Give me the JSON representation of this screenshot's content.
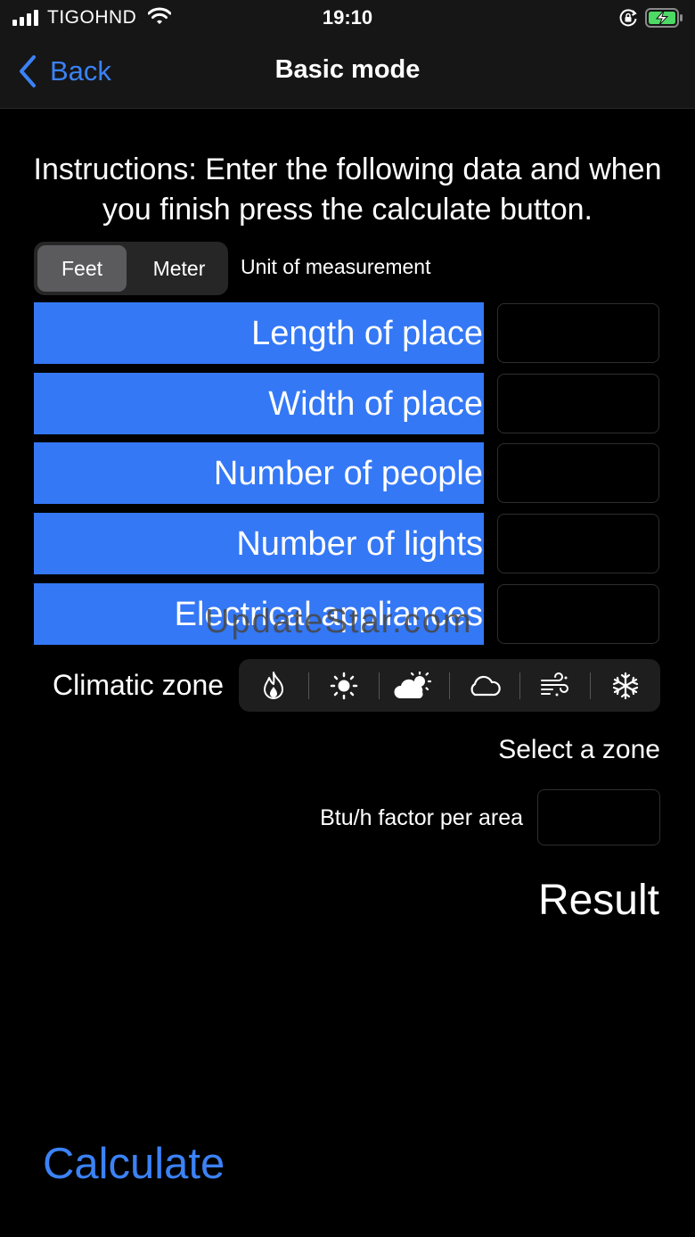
{
  "status_bar": {
    "carrier": "TIGOHND",
    "time": "19:10",
    "icons": [
      "signal-icon",
      "wifi-icon",
      "rotation-lock-icon",
      "battery-charging-icon"
    ]
  },
  "nav": {
    "back_label": "Back",
    "title": "Basic mode"
  },
  "instructions": "Instructions: Enter the following data and when you finish press the calculate button.",
  "unit": {
    "options": [
      "Feet",
      "Meter"
    ],
    "selected": "Feet",
    "label": "Unit of measurement"
  },
  "fields": [
    {
      "label": "Length of place",
      "value": ""
    },
    {
      "label": "Width of place",
      "value": ""
    },
    {
      "label": "Number of people",
      "value": ""
    },
    {
      "label": "Number of lights",
      "value": ""
    },
    {
      "label": "Electrical appliances",
      "value": ""
    }
  ],
  "watermark": "UpdateStar.com",
  "climatic_zone": {
    "label": "Climatic zone",
    "options": [
      "flame-icon",
      "sun-icon",
      "sun-behind-cloud-icon",
      "cloud-icon",
      "wind-icon",
      "snowflake-icon"
    ],
    "status": "Select a zone"
  },
  "factor": {
    "label": "Btu/h factor per area",
    "value": ""
  },
  "result_label": "Result",
  "calculate_label": "Calculate",
  "colors": {
    "accent": "#3b82f6",
    "field_label_bg": "#3478f6",
    "background": "#000000",
    "bar_background": "#161616"
  }
}
